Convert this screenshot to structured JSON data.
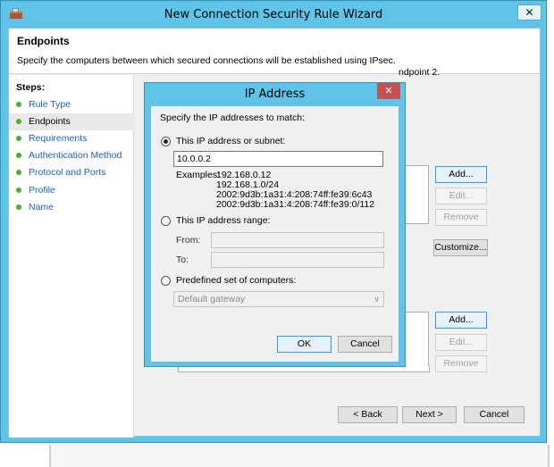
{
  "window": {
    "title": "New Connection Security Rule Wizard",
    "close_glyph": "✕"
  },
  "header": {
    "title": "Endpoints",
    "description": "Specify the computers between which secured connections will be established using IPsec."
  },
  "steps": {
    "heading": "Steps:",
    "items": [
      {
        "label": "Rule Type",
        "active": false
      },
      {
        "label": "Endpoints",
        "active": true
      },
      {
        "label": "Requirements",
        "active": false
      },
      {
        "label": "Authentication Method",
        "active": false
      },
      {
        "label": "Protocol and Ports",
        "active": false
      },
      {
        "label": "Profile",
        "active": false
      },
      {
        "label": "Name",
        "active": false
      }
    ]
  },
  "content": {
    "partial_text": "ndpoint 2.",
    "buttons": {
      "add_1": "Add...",
      "edit_1": "Edit...",
      "remove_1": "Remove",
      "customize": "Customize...",
      "add_2": "Add...",
      "edit_2": "Edit...",
      "remove_2": "Remove"
    }
  },
  "footer": {
    "back": "< Back",
    "next": "Next >",
    "cancel": "Cancel"
  },
  "dialog": {
    "title": "IP Address",
    "close_glyph": "✕",
    "prompt": "Specify the IP addresses to match:",
    "option_subnet": "This IP address or subnet:",
    "ip_value": "10.0.0.2",
    "examples_label": "Examples:",
    "examples": [
      "192.168.0.12",
      "192.168.1.0/24",
      "2002:9d3b:1a31:4:208:74ff:fe39:6c43",
      "2002:9d3b:1a31:4:208:74ff:fe39:0/112"
    ],
    "option_range": "This IP address range:",
    "from_label": "From:",
    "to_label": "To:",
    "option_predefined": "Predefined set of computers:",
    "predefined_value": "Default gateway",
    "ok": "OK",
    "cancel": "Cancel"
  },
  "colors": {
    "title_bar": "#5fc4e8",
    "link": "#1c64b4",
    "step_bullet": "#4fae31",
    "dialog_close": "#c75050"
  }
}
